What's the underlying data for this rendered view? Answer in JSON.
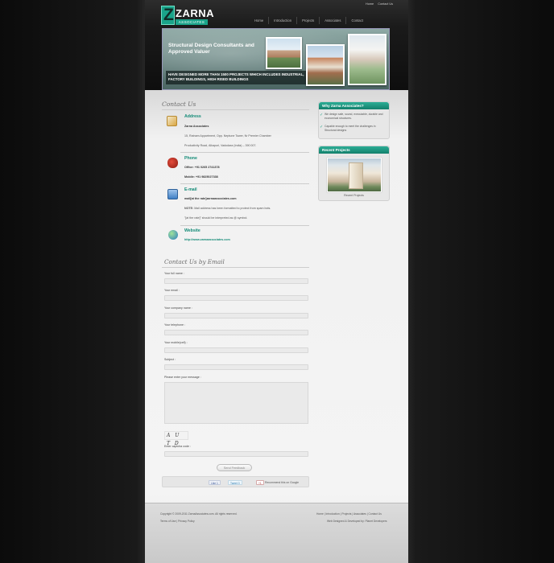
{
  "brand": {
    "name": "ZARNA",
    "subtitle": "ASSOCIATES",
    "logo_letter": "Z",
    "accent": "#1aa38a"
  },
  "top_links": [
    "Home",
    "Contact Us"
  ],
  "nav": [
    "Home",
    "Introduction",
    "Projects",
    "Associates",
    "Contact"
  ],
  "banner": {
    "title": "Structural Design Consultants and Approved Valuer",
    "subtitle": "HAVE DESIGNED MORE THAN 1500 PROJECTS WHICH INCLUDES INDUSTRIAL, FACTORY BUILDINGS, HIGH RISED BUILDINGS"
  },
  "contact": {
    "title": "Contact Us",
    "address": {
      "heading": "Address",
      "company": "Zarna Associates",
      "line1": "15, Ratnam Appartment, Opp. Neptune Tower, Nr Premier Chamber",
      "line2": "Productivity Road, Alkapuri, Vadodara (India) – 390 007."
    },
    "phone": {
      "heading": "Phone",
      "office": "Office: +91 0265 2741378",
      "mobile": "Mobile: +91 9825027338"
    },
    "email": {
      "heading": "E-mail",
      "address": "mail[at the rate]zarnaassociates.com",
      "note_label": "NOTE:",
      "note": "Mail address has been formatted to protect from spam bots.",
      "note2": "\"[at the rate]\" should be interpreted as @ symbol."
    },
    "website": {
      "heading": "Website",
      "url": "http://www.zarnaassociates.com"
    }
  },
  "form": {
    "title": "Contact Us by Email",
    "labels": {
      "full_name": "Your full name :",
      "email": "Your email :",
      "company": "Your company name :",
      "telephone": "Your telephone :",
      "mobile": "Your mobile(cell) :",
      "subject": "Subject :",
      "message": "Please enter your message :",
      "captcha": "Enter captcha code :"
    },
    "captcha_text": "A U T D",
    "send_label": "Send Feedback"
  },
  "share": {
    "like": "Like",
    "like_count": "1",
    "tweet": "Tweet",
    "tweet_count": "0",
    "gplus": "+1",
    "recommend": "Recommend this on Google"
  },
  "sidebar": {
    "why_title": "Why Zarna Associates?",
    "why_items": [
      "We design safe, sound, executable, durable and economical structures.",
      "Capable enough to meet the challenges in Structural designs"
    ],
    "projects_title": "Recent Projects",
    "projects_caption": "Recent Projects"
  },
  "footer": {
    "copyright": "Copyright © 2009-2011 ZarnaAssociates.com. All rights reserved.",
    "links_left": [
      "Terms of Use",
      "Privacy Policy"
    ],
    "links_right": [
      "Home",
      "Introduction",
      "Projects",
      "Associates",
      "Contact Us"
    ],
    "credit": "Web Designed & Developed by: Planet Developers"
  }
}
